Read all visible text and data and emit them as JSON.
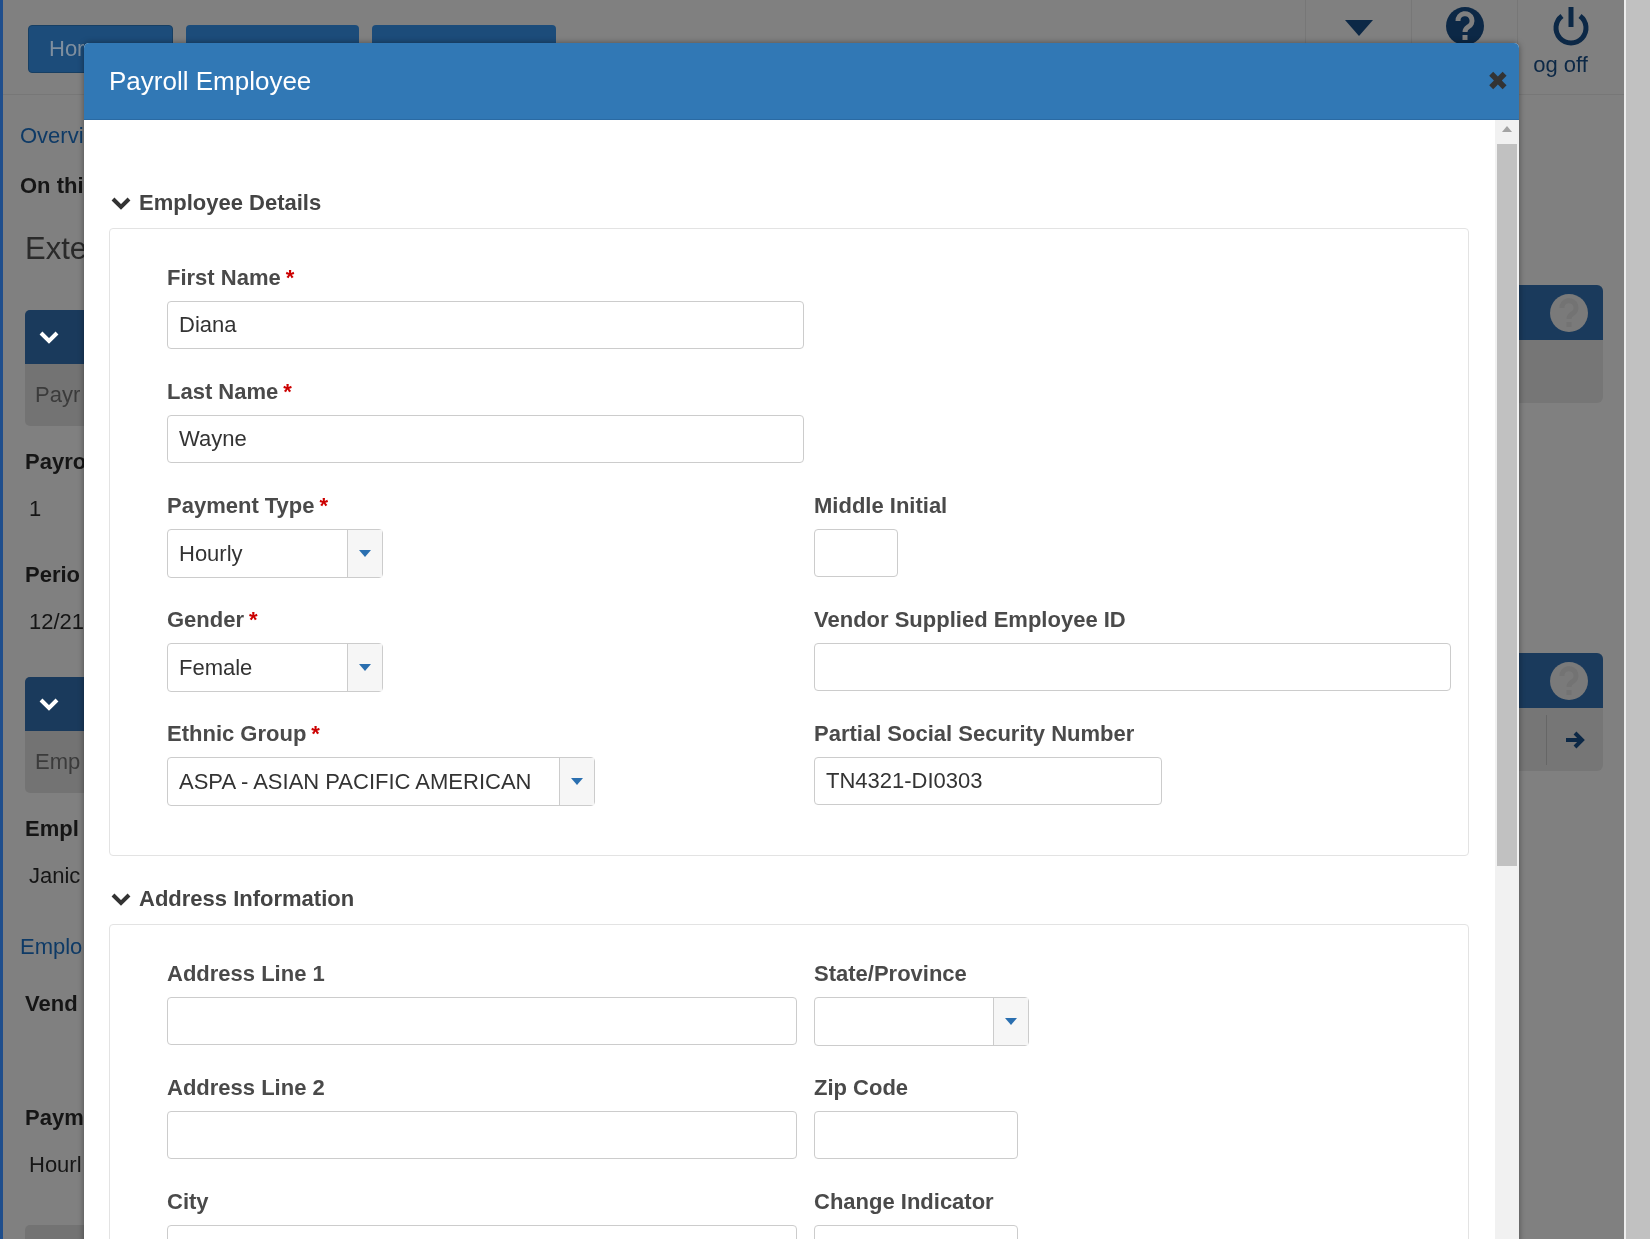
{
  "background_page": {
    "nav_buttons": [
      "Hor"
    ],
    "log_off": "og off",
    "left_items": [
      {
        "kind": "link",
        "text": "Overvi"
      },
      {
        "kind": "heading",
        "text": "On thi"
      },
      {
        "kind": "title",
        "text": "Exte"
      },
      {
        "kind": "panel",
        "text": "Payr"
      },
      {
        "kind": "label",
        "text": "Payro"
      },
      {
        "kind": "value",
        "text": "1"
      },
      {
        "kind": "label",
        "text": "Perio"
      },
      {
        "kind": "value",
        "text": "12/21"
      },
      {
        "kind": "panel",
        "text": "Emp"
      },
      {
        "kind": "label",
        "text": "Empl"
      },
      {
        "kind": "value",
        "text": "Janic"
      },
      {
        "kind": "link",
        "text": "Emplo"
      },
      {
        "kind": "label",
        "text": "Vend"
      },
      {
        "kind": "label",
        "text": "Paym"
      },
      {
        "kind": "value",
        "text": "Hourl"
      },
      {
        "kind": "panel-header"
      }
    ],
    "right_panels": [
      {
        "kind": "plain"
      },
      {
        "kind": "arrow"
      }
    ]
  },
  "dialog": {
    "title": "Payroll Employee",
    "close": "✖",
    "sections": [
      {
        "title": "Employee Details",
        "expanded": true,
        "rows": [
          [
            {
              "kind": "text",
              "label": "First Name",
              "required_mark": "*",
              "value": "Diana"
            },
            null
          ],
          [
            {
              "kind": "text",
              "label": "Last Name",
              "required_mark": "*",
              "value": "Wayne"
            },
            null
          ],
          [
            {
              "kind": "select",
              "label": "Payment Type",
              "required_mark": "*",
              "value": "Hourly"
            },
            {
              "kind": "text",
              "label": "Middle Initial"
            }
          ],
          [
            {
              "kind": "select",
              "label": "Gender",
              "required_mark": "*",
              "value": "Female"
            },
            {
              "kind": "text",
              "label": "Vendor Supplied Employee ID"
            }
          ],
          [
            {
              "kind": "select",
              "label": "Ethnic Group",
              "required_mark": "*",
              "value": "ASPA - ASIAN PACIFIC AMERICAN"
            },
            {
              "kind": "text",
              "label": "Partial Social Security Number",
              "value": "TN4321-DI0303"
            }
          ]
        ]
      },
      {
        "title": "Address Information",
        "expanded": true,
        "rows": [
          [
            {
              "kind": "text",
              "label": "Address Line 1"
            },
            {
              "kind": "select",
              "label": "State/Province"
            }
          ],
          [
            {
              "kind": "text",
              "label": "Address Line 2"
            },
            {
              "kind": "text",
              "label": "Zip Code"
            }
          ],
          [
            {
              "kind": "text",
              "label": "City"
            },
            {
              "kind": "text",
              "label": "Change Indicator"
            }
          ]
        ]
      }
    ]
  }
}
